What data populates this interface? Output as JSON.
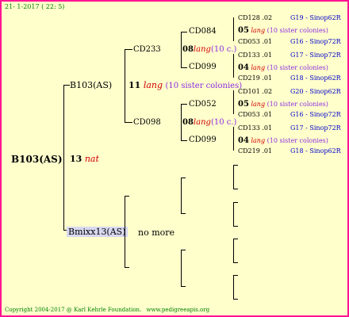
{
  "header": "21- 1-2017 ( 22: 5)",
  "root": {
    "name": "B103(AS)",
    "num": "13",
    "tag": "nat"
  },
  "father": {
    "name": "B103(AS)",
    "num": "11",
    "tag": "lang",
    "extra": "(10 sister colonies)"
  },
  "mother": {
    "name": "Bmixx13(AS)",
    "note": "no more"
  },
  "gf": [
    {
      "name": "CD233",
      "num": "08",
      "tag": "lang",
      "extra": "(10 c.)"
    },
    {
      "name": "CD098",
      "num": "08",
      "tag": "lang",
      "extra": "(10 c.)"
    }
  ],
  "ggf": [
    {
      "name": "CD084",
      "num": "05",
      "tag": "lang",
      "extra": "(10 sister colonies)",
      "top": {
        "id": "CD128",
        "num": ".02",
        "ref": "G19 - Sinop62R"
      },
      "bot": {
        "id": "CD053",
        "num": ".01",
        "ref": "G16 - Sinop72R"
      }
    },
    {
      "name": "CD099",
      "num": "04",
      "tag": "lang",
      "extra": "(10 sister colonies)",
      "top": {
        "id": "CD133",
        "num": ".01",
        "ref": "G17 - Sinop72R"
      },
      "bot": {
        "id": "CD219",
        "num": ".01",
        "ref": "G18 - Sinop62R"
      }
    },
    {
      "name": "CD052",
      "num": "05",
      "tag": "lang",
      "extra": "(10 sister colonies)",
      "top": {
        "id": "CD101",
        "num": ".02",
        "ref": "G20 - Sinop62R"
      },
      "bot": {
        "id": "CD053",
        "num": ".01",
        "ref": "G16 - Sinop72R"
      }
    },
    {
      "name": "CD099",
      "num": "04",
      "tag": "lang",
      "extra": "(10 sister colonies)",
      "top": {
        "id": "CD133",
        "num": ".01",
        "ref": "G17 - Sinop72R"
      },
      "bot": {
        "id": "CD219",
        "num": ".01",
        "ref": "G18 - Sinop62R"
      }
    }
  ],
  "footer": {
    "copyright": "Copyright 2004-2017 @ Karl Kehrle Foundation.",
    "url": "www.pedigreeapis.org"
  }
}
